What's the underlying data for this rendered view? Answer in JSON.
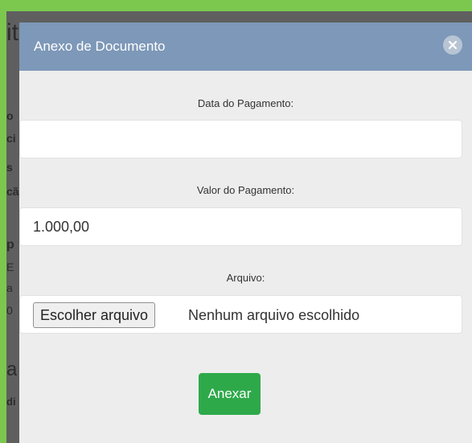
{
  "modal": {
    "title": "Anexo de Documento",
    "close_icon": "close-circle-icon",
    "fields": {
      "payment_date": {
        "label": "Data do Pagamento:",
        "value": ""
      },
      "payment_value": {
        "label": "Valor do Pagamento:",
        "value": "1.000,00"
      },
      "file": {
        "label": "Arquivo:",
        "button_label": "Escolher arquivo",
        "status": "Nenhum arquivo escolhido"
      }
    },
    "submit_label": "Anexar"
  },
  "background": {
    "fragments": [
      "it",
      "o",
      "ci",
      "s",
      "cã",
      "p",
      "E",
      "a",
      "0",
      "a",
      "di"
    ]
  },
  "colors": {
    "outer_border": "#7cc84f",
    "header": "#7d98b8",
    "submit_button": "#2ea94a",
    "modal_body": "#ededed"
  }
}
